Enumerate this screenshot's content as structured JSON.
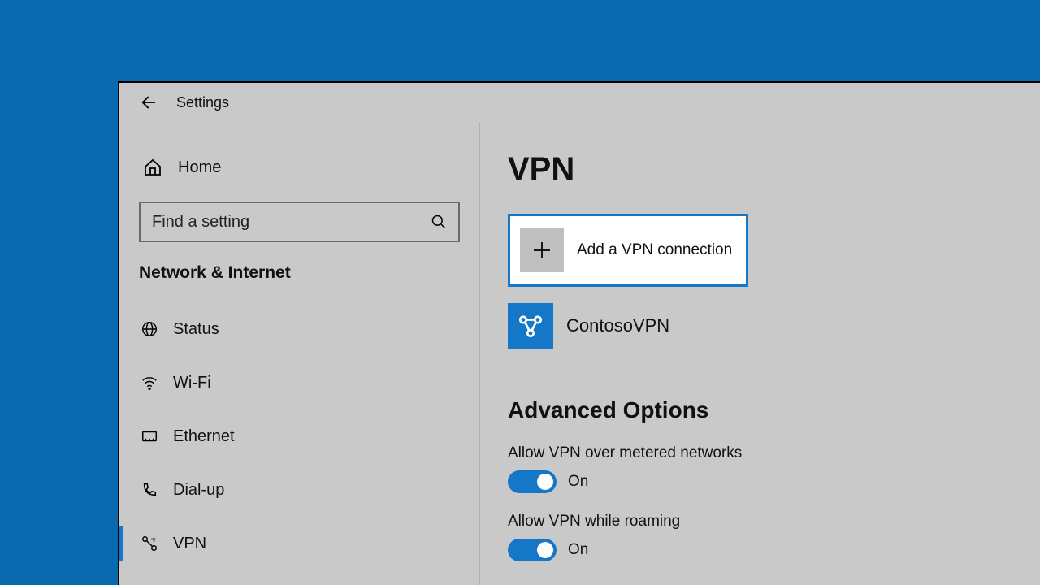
{
  "app": {
    "title": "Settings"
  },
  "sidebar": {
    "home_label": "Home",
    "search_placeholder": "Find a setting",
    "section_heading": "Network & Internet",
    "items": [
      {
        "label": "Status"
      },
      {
        "label": "Wi-Fi"
      },
      {
        "label": "Ethernet"
      },
      {
        "label": "Dial-up"
      },
      {
        "label": "VPN"
      }
    ]
  },
  "main": {
    "page_title": "VPN",
    "add_button_label": "Add a VPN connection",
    "connections": [
      {
        "name": "ContosoVPN"
      }
    ],
    "advanced_heading": "Advanced Options",
    "options": [
      {
        "label": "Allow VPN over metered networks",
        "state_label": "On",
        "enabled": true
      },
      {
        "label": "Allow VPN while roaming",
        "state_label": "On",
        "enabled": true
      }
    ]
  },
  "colors": {
    "accent": "#1477c8",
    "window_bg": "#c9c9c9",
    "desktop": "#0a6ab0"
  }
}
